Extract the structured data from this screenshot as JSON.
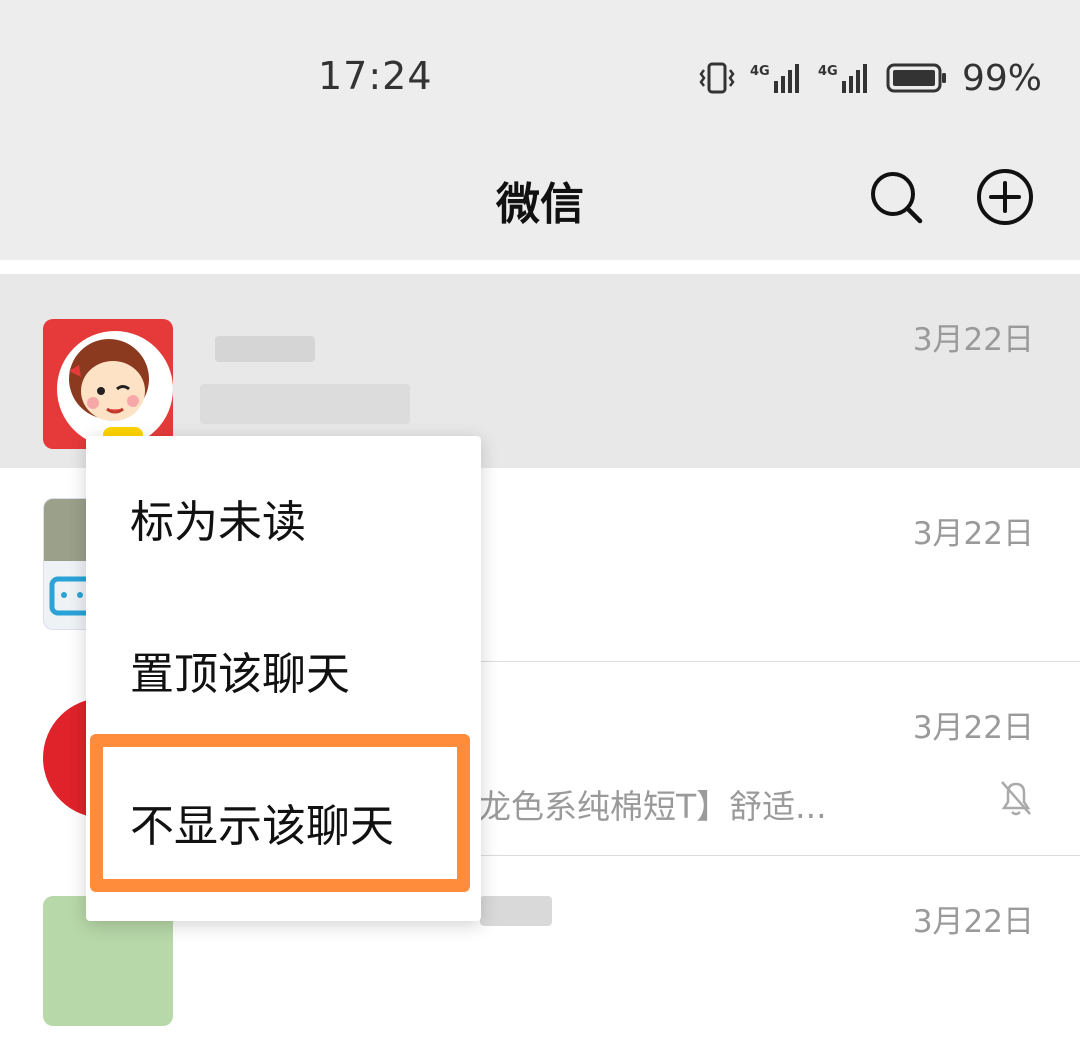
{
  "status_bar": {
    "time": "17:24",
    "battery": "99%",
    "network_1": "4G",
    "network_2": "4G"
  },
  "header": {
    "title": "微信"
  },
  "chats": [
    {
      "time": "3月22日"
    },
    {
      "time": "3月22日"
    },
    {
      "time": "3月22日",
      "preview": "龙色系纯棉短T】舒适..."
    },
    {
      "time": "3月22日"
    }
  ],
  "context_menu": {
    "items": [
      "标为未读",
      "置顶该聊天",
      "不显示该聊天"
    ]
  },
  "colors": {
    "highlight": "#ff8c3a",
    "background": "#ededed"
  }
}
